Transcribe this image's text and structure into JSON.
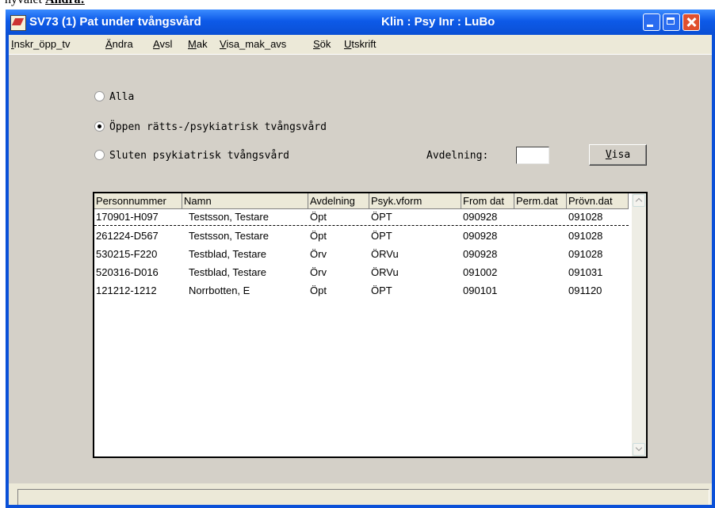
{
  "caption": {
    "prefix": "hyvalet ",
    "highlight": "Ändra:"
  },
  "window": {
    "title": "SV73 (1) Pat under tvångsvård",
    "title_right": "Klin : Psy  Inr : LuBo",
    "colors": {
      "titlebar": "#0a50d8",
      "client": "#d4d0c8",
      "close": "#e0502e"
    }
  },
  "menu": [
    "Inskr_öpp_tv",
    "Ändra",
    "Avsl",
    "Mak",
    "Visa_mak_avs",
    "Sök",
    "Utskrift"
  ],
  "filters": {
    "options": [
      {
        "label": "Alla",
        "selected": false
      },
      {
        "label": "Öppen rätts-/psykiatrisk tvångsvård",
        "selected": true
      },
      {
        "label": "Sluten psykiatrisk tvångsvård",
        "selected": false
      }
    ],
    "avdelning_label": "Avdelning:",
    "avdelning_value": "",
    "visa_button": "Visa"
  },
  "table": {
    "columns": [
      "Personnummer",
      "Namn",
      "Avdelning",
      "Psyk.vform",
      "From dat",
      "Perm.dat",
      "Prövn.dat"
    ],
    "rows": [
      [
        "170901-H097",
        "Testsson, Testare",
        "Öpt",
        "ÖPT",
        "090928",
        "",
        "091028"
      ],
      [
        "261224-D567",
        "Testsson, Testare",
        "Öpt",
        "ÖPT",
        "090928",
        "",
        "091028"
      ],
      [
        "530215-F220",
        "Testblad, Testare",
        "Örv",
        "ÖRVu",
        "090928",
        "",
        "091028"
      ],
      [
        "520316-D016",
        "Testblad, Testare",
        "Örv",
        "ÖRVu",
        "091002",
        "",
        "091031"
      ],
      [
        "121212-1212",
        "Norrbotten, E",
        "Öpt",
        "ÖPT",
        "090101",
        "",
        "091120"
      ]
    ]
  },
  "status": ""
}
